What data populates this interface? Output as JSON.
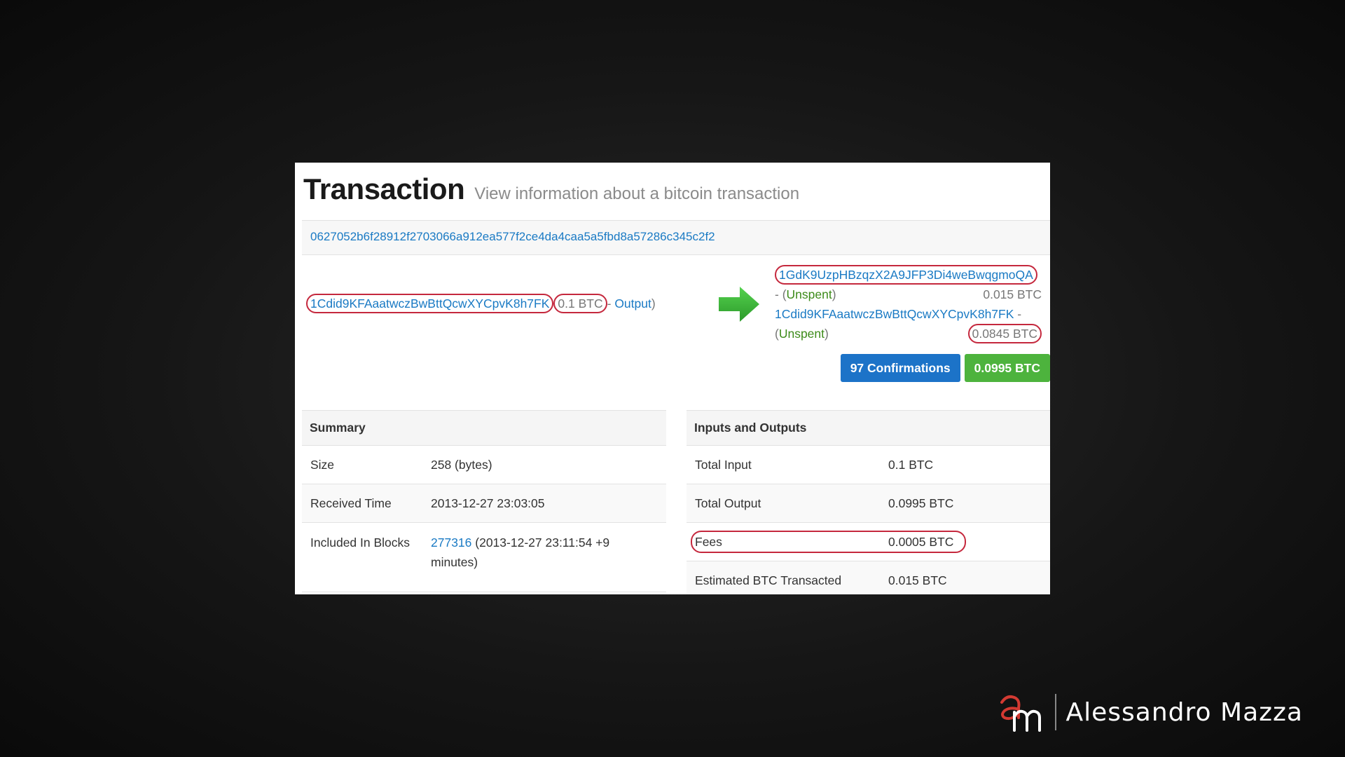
{
  "header": {
    "title": "Transaction",
    "subtitle": "View information about a bitcoin transaction"
  },
  "tx_hash": "0627052b6f28912f2703066a912ea577f2ce4da4caa5a5fbd8a57286c345c2f2",
  "input": {
    "address": "1Cdid9KFAaatwczBwBttQcwXYCpvK8h7FK",
    "amount": "0.1 BTC",
    "sep_open": " (",
    "dash": "- ",
    "output_link": "Output",
    "close": ")"
  },
  "outputs": [
    {
      "address": "1GdK9UzpHBzqzX2A9JFP3Di4weBwqgmoQA",
      "prefix": "- (",
      "status": "Unspent",
      "suffix": ")",
      "amount": "0.015 BTC"
    },
    {
      "address": "1Cdid9KFAaatwczBwBttQcwXYCpvK8h7FK",
      "dash": " -",
      "prefix": "(",
      "status": "Unspent",
      "suffix": ")",
      "amount": "0.0845 BTC"
    }
  ],
  "badges": {
    "confirmations": "97 Confirmations",
    "total": "0.0995 BTC"
  },
  "summary": {
    "heading": "Summary",
    "size_label": "Size",
    "size_value": "258 (bytes)",
    "received_label": "Received Time",
    "received_value": "2013-12-27 23:03:05",
    "included_label": "Included In Blocks",
    "block_link": "277316",
    "block_detail": " (2013-12-27 23:11:54 +9 minutes)"
  },
  "io": {
    "heading": "Inputs and Outputs",
    "total_input_label": "Total Input",
    "total_input_value": "0.1 BTC",
    "total_output_label": "Total Output",
    "total_output_value": "0.0995 BTC",
    "fees_label": "Fees",
    "fees_value": "0.0005 BTC",
    "estimated_label": "Estimated BTC Transacted",
    "estimated_value": "0.015 BTC"
  },
  "branding": {
    "logo_letters": "am",
    "name": "Alessandro Mazza"
  },
  "colors": {
    "link": "#1a7ac4",
    "highlight_circle": "#c5283d",
    "confirm_badge": "#1c73c8",
    "amount_badge": "#4db33d",
    "arrow": "#3db83a"
  }
}
